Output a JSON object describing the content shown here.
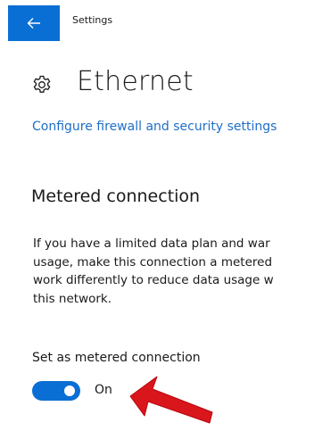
{
  "header": {
    "back_icon": "arrow-left-icon",
    "title": "Settings"
  },
  "page": {
    "icon": "gear-icon",
    "title": "Ethernet"
  },
  "link": {
    "firewall": "Configure firewall and security settings"
  },
  "metered": {
    "heading": "Metered connection",
    "description_lines": [
      "If you have a limited data plan and war",
      "usage, make this connection a metered",
      "work differently to reduce data usage w",
      "this network."
    ],
    "toggle_label": "Set as metered connection",
    "toggle_state": "On",
    "toggle_on": true
  },
  "annotation": {
    "arrow_icon": "red-arrow-icon"
  },
  "colors": {
    "accent": "#0a6fd4",
    "link": "#1e6fc7",
    "arrow": "#d9161c"
  }
}
